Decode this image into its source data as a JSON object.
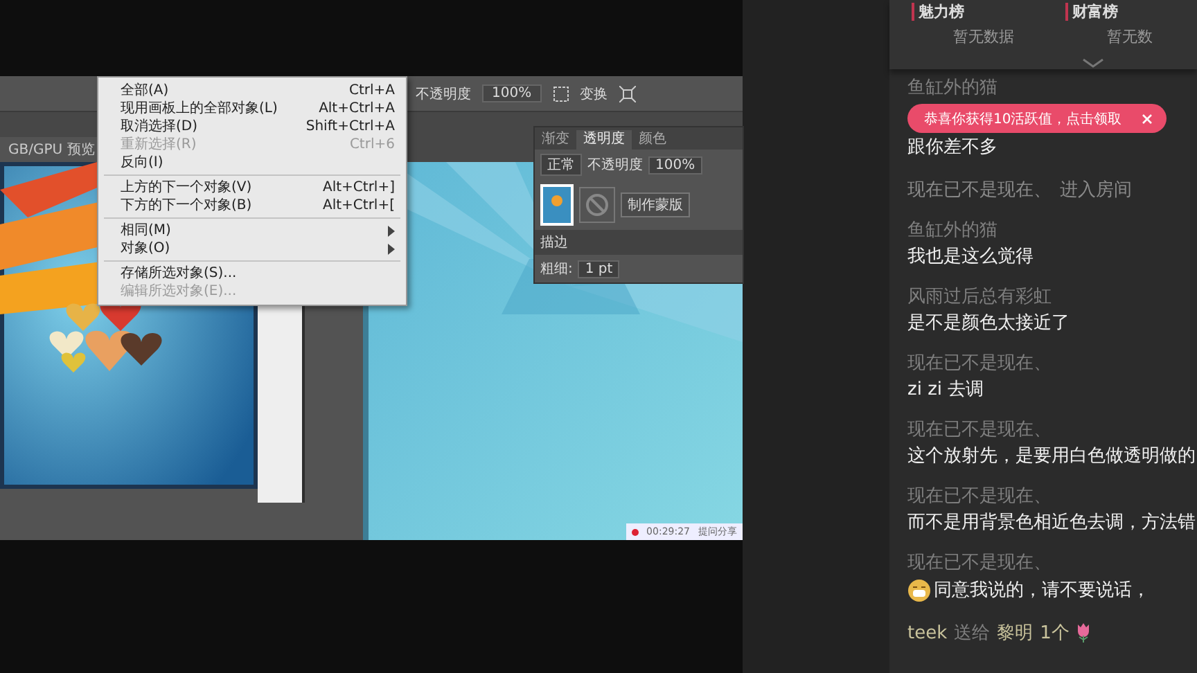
{
  "video": {
    "toolbar": {
      "opacity_label": "不透明度",
      "opacity_value": "100%",
      "transform_label": "变换"
    },
    "document_tab": "GB/GPU 预览",
    "select_menu": [
      {
        "kind": "item",
        "label": "全部(A)",
        "shortcut": "Ctrl+A",
        "disabled": false
      },
      {
        "kind": "item",
        "label": "现用画板上的全部对象(L)",
        "shortcut": "Alt+Ctrl+A",
        "disabled": false
      },
      {
        "kind": "item",
        "label": "取消选择(D)",
        "shortcut": "Shift+Ctrl+A",
        "disabled": false
      },
      {
        "kind": "item",
        "label": "重新选择(R)",
        "shortcut": "Ctrl+6",
        "disabled": true
      },
      {
        "kind": "item",
        "label": "反向(I)",
        "disabled": false
      },
      {
        "kind": "separator"
      },
      {
        "kind": "item",
        "label": "上方的下一个对象(V)",
        "shortcut": "Alt+Ctrl+]",
        "disabled": false
      },
      {
        "kind": "item",
        "label": "下方的下一个对象(B)",
        "shortcut": "Alt+Ctrl+[",
        "disabled": false
      },
      {
        "kind": "separator"
      },
      {
        "kind": "submenu",
        "label": "相同(M)",
        "disabled": false
      },
      {
        "kind": "submenu",
        "label": "对象(O)",
        "disabled": false
      },
      {
        "kind": "separator"
      },
      {
        "kind": "item",
        "label": "存储所选对象(S)...",
        "disabled": false
      },
      {
        "kind": "item",
        "label": "编辑所选对象(E)...",
        "disabled": true
      }
    ],
    "transparency_panel": {
      "tabs": [
        {
          "label": "渐变",
          "selected": false
        },
        {
          "label": "透明度",
          "selected": true
        },
        {
          "label": "颜色",
          "selected": false
        }
      ],
      "blend_mode": "正常",
      "opacity_label": "不透明度",
      "opacity_value": "100%",
      "mask_button": "制作蒙版",
      "stroke_title": "描边",
      "weight_label": "粗细:",
      "weight_value": "1 pt"
    },
    "recording": {
      "time": "00:29:27",
      "label": "提问分享"
    }
  },
  "rankings": [
    {
      "title": "魅力榜",
      "empty_text": "暂无数据"
    },
    {
      "title": "财富榜",
      "empty_text": "暂无数"
    }
  ],
  "toast": {
    "text": "恭喜你获得10活跃值，点击领取"
  },
  "chat": [
    {
      "kind": "message",
      "user": "鱼缸外的猫",
      "text": "跟你差不多",
      "sticker": false
    },
    {
      "kind": "enter",
      "user": "现在已不是现在、",
      "text": "进入房间"
    },
    {
      "kind": "message",
      "user": "鱼缸外的猫",
      "text": "我也是这么觉得",
      "sticker": false
    },
    {
      "kind": "message",
      "user": "风雨过后总有彩虹",
      "text": "是不是颜色太接近了",
      "sticker": false
    },
    {
      "kind": "message",
      "user": "现在已不是现在、",
      "text": "zi zi 去调",
      "sticker": false
    },
    {
      "kind": "message",
      "user": "现在已不是现在、",
      "text": "这个放射先，是要用白色做透明做的",
      "sticker": false
    },
    {
      "kind": "message",
      "user": "现在已不是现在、",
      "text": "而不是用背景色相近色去调，方法错",
      "sticker": false
    },
    {
      "kind": "message",
      "user": "现在已不是现在、",
      "text": "同意我说的，请不要说话，",
      "sticker": true
    },
    {
      "kind": "gift",
      "user": "teek",
      "verb": "送给",
      "target": "黎明",
      "amount": "1个"
    }
  ]
}
